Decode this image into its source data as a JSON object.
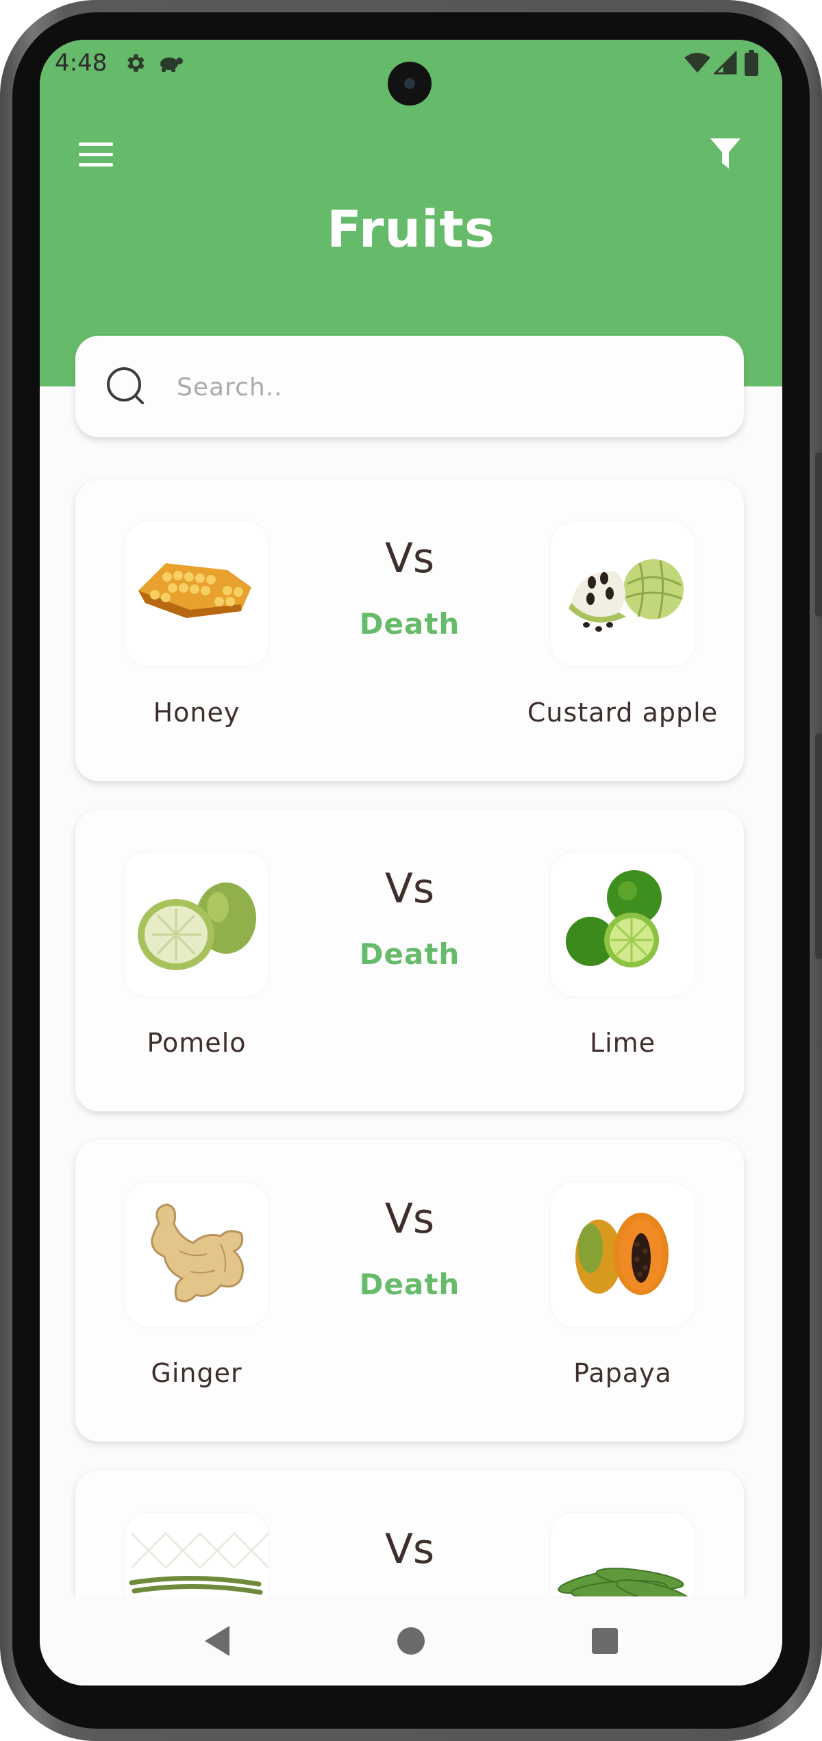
{
  "status_bar": {
    "time": "4:48",
    "icons": [
      "gear-icon",
      "turtle-icon",
      "wifi-icon",
      "cellular-signal-icon",
      "battery-icon"
    ]
  },
  "header": {
    "title": "Fruits",
    "menu_icon": "hamburger-menu-icon",
    "filter_icon": "filter-funnel-icon",
    "background_color": "#66bb6a"
  },
  "search": {
    "placeholder": "Search..",
    "value": "",
    "icon": "search-icon"
  },
  "cards": [
    {
      "left": "Honey",
      "left_image": "honeycomb",
      "vs": "Vs",
      "result": "Death",
      "right": "Custard apple",
      "right_image": "custard-apple"
    },
    {
      "left": "Pomelo",
      "left_image": "pomelo",
      "vs": "Vs",
      "result": "Death",
      "right": "Lime",
      "right_image": "lime"
    },
    {
      "left": "Ginger",
      "left_image": "ginger-root",
      "vs": "Vs",
      "result": "Death",
      "right": "Papaya",
      "right_image": "papaya"
    },
    {
      "left": "",
      "left_image": "green-beans",
      "vs": "Vs",
      "result": "",
      "right": "",
      "right_image": "green-peas"
    }
  ],
  "accent_color": "#66bb6a",
  "nav_bar": {
    "back_icon": "back-triangle-icon",
    "home_icon": "home-circle-icon",
    "recents_icon": "recents-square-icon"
  }
}
